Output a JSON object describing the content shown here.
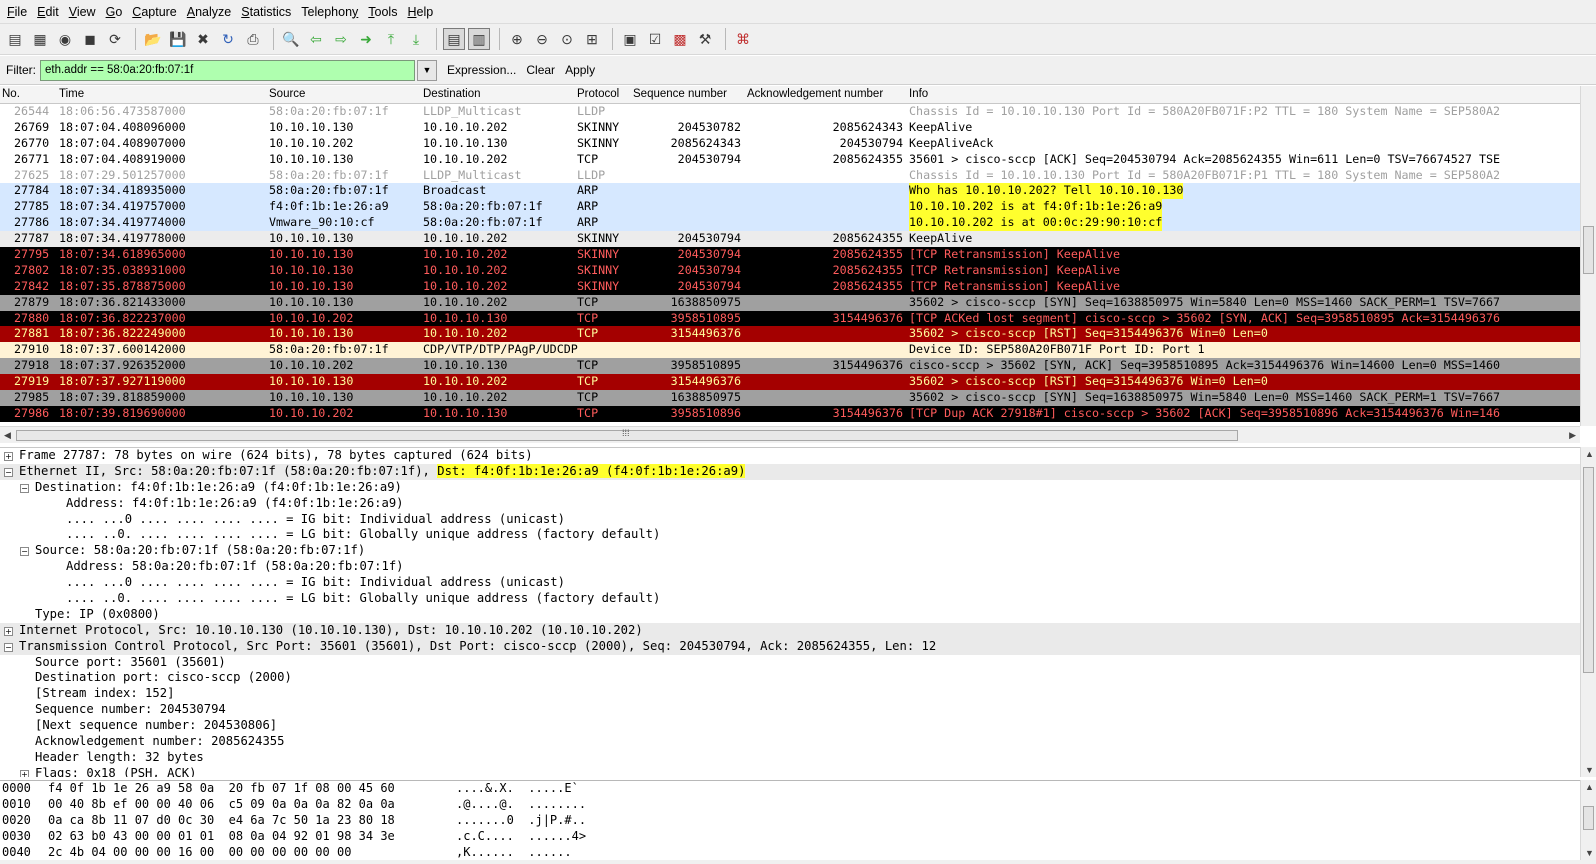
{
  "menu": [
    {
      "pre": "",
      "u": "F",
      "post": "ile"
    },
    {
      "pre": "",
      "u": "E",
      "post": "dit"
    },
    {
      "pre": "",
      "u": "V",
      "post": "iew"
    },
    {
      "pre": "",
      "u": "G",
      "post": "o"
    },
    {
      "pre": "",
      "u": "C",
      "post": "apture"
    },
    {
      "pre": "",
      "u": "A",
      "post": "nalyze"
    },
    {
      "pre": "",
      "u": "S",
      "post": "tatistics"
    },
    {
      "pre": "Telephon",
      "u": "y",
      "post": ""
    },
    {
      "pre": "",
      "u": "T",
      "post": "ools"
    },
    {
      "pre": "",
      "u": "H",
      "post": "elp"
    }
  ],
  "toolbar": [
    {
      "name": "interface-list-icon",
      "glyph": "▤",
      "cls": "ic-dark"
    },
    {
      "name": "capture-options-icon",
      "glyph": "▦",
      "cls": "ic-dark"
    },
    {
      "name": "start-capture-icon",
      "glyph": "◉",
      "cls": "ic-dark"
    },
    {
      "name": "stop-capture-icon",
      "glyph": "◼",
      "cls": "ic-dark"
    },
    {
      "name": "restart-capture-icon",
      "glyph": "⟳",
      "cls": "ic-dark"
    },
    {
      "name": "sep"
    },
    {
      "name": "open-file-icon",
      "glyph": "📂",
      "cls": "ic-orange"
    },
    {
      "name": "save-file-icon",
      "glyph": "💾",
      "cls": "ic-red"
    },
    {
      "name": "close-file-icon",
      "glyph": "✖",
      "cls": "ic-dark"
    },
    {
      "name": "reload-icon",
      "glyph": "↻",
      "cls": "ic-blue"
    },
    {
      "name": "print-icon",
      "glyph": "⎙",
      "cls": "ic-dark"
    },
    {
      "name": "sep"
    },
    {
      "name": "find-packet-icon",
      "glyph": "🔍",
      "cls": "ic-dark"
    },
    {
      "name": "go-back-icon",
      "glyph": "⇦",
      "cls": "ic-green"
    },
    {
      "name": "go-forward-icon",
      "glyph": "⇨",
      "cls": "ic-green"
    },
    {
      "name": "go-to-packet-icon",
      "glyph": "➜",
      "cls": "ic-green"
    },
    {
      "name": "go-first-icon",
      "glyph": "⤒",
      "cls": "ic-green"
    },
    {
      "name": "go-last-icon",
      "glyph": "⤓",
      "cls": "ic-green"
    },
    {
      "name": "sep"
    },
    {
      "name": "colorize-icon",
      "glyph": "▤",
      "cls": "ic-dark",
      "pressed": true
    },
    {
      "name": "auto-scroll-icon",
      "glyph": "▥",
      "cls": "ic-dark",
      "pressed": true
    },
    {
      "name": "sep"
    },
    {
      "name": "zoom-in-icon",
      "glyph": "⊕",
      "cls": "ic-dark"
    },
    {
      "name": "zoom-out-icon",
      "glyph": "⊖",
      "cls": "ic-dark"
    },
    {
      "name": "zoom-normal-icon",
      "glyph": "⊙",
      "cls": "ic-dark"
    },
    {
      "name": "resize-columns-icon",
      "glyph": "⊞",
      "cls": "ic-dark"
    },
    {
      "name": "sep"
    },
    {
      "name": "capture-filters-icon",
      "glyph": "▣",
      "cls": "ic-dark"
    },
    {
      "name": "display-filters-icon",
      "glyph": "☑",
      "cls": "ic-dark"
    },
    {
      "name": "coloring-rules-icon",
      "glyph": "▩",
      "cls": "ic-red"
    },
    {
      "name": "preferences-icon",
      "glyph": "⚒",
      "cls": "ic-dark"
    },
    {
      "name": "sep"
    },
    {
      "name": "help-icon",
      "glyph": "⌘",
      "cls": "ic-red"
    }
  ],
  "filter": {
    "label": "Filter:",
    "value": "eth.addr == 58:0a:20:fb:07:1f",
    "expression": "Expression...",
    "clear": "Clear",
    "apply": "Apply"
  },
  "columns": {
    "no": "No.",
    "time": "Time",
    "source": "Source",
    "destination": "Destination",
    "protocol": "Protocol",
    "seq": "Sequence number",
    "ack": "Acknowledgement number",
    "info": "Info"
  },
  "colors": {
    "lldp_bg": "#ffffff",
    "lldp_fg": "#a0a0a0",
    "skinny_bg": "#ffffff",
    "skinny_fg": "#000000",
    "arp_bg": "#d6e8ff",
    "arp_fg": "#000000",
    "retrans_bg": "#000000",
    "retrans_fg": "#ff5c5c",
    "syn_bg": "#a0a0a0",
    "syn_fg": "#000000",
    "rst_bg": "#a40000",
    "rst_fg": "#fffc9c",
    "cdp_bg": "#fff3d6",
    "cdp_fg": "#000000",
    "highlight": "#ffff2e"
  },
  "packets": [
    {
      "no": "26544",
      "time": "18:06:56.473587000",
      "src": "58:0a:20:fb:07:1f",
      "dst": "LLDP_Multicast",
      "proto": "LLDP",
      "seq": "",
      "ack": "",
      "info": "Chassis Id = 10.10.10.130 Port Id = 580A20FB071F:P2 TTL = 180 System Name = SEP580A2",
      "bg": "#ffffff",
      "fg": "#a0a0a0"
    },
    {
      "no": "26769",
      "time": "18:07:04.408096000",
      "src": "10.10.10.130",
      "dst": "10.10.10.202",
      "proto": "SKINNY",
      "seq": "204530782",
      "ack": "2085624343",
      "info": "KeepAlive",
      "bg": "#ffffff",
      "fg": "#000000"
    },
    {
      "no": "26770",
      "time": "18:07:04.408907000",
      "src": "10.10.10.202",
      "dst": "10.10.10.130",
      "proto": "SKINNY",
      "seq": "2085624343",
      "ack": "204530794",
      "info": "KeepAliveAck",
      "bg": "#ffffff",
      "fg": "#000000"
    },
    {
      "no": "26771",
      "time": "18:07:04.408919000",
      "src": "10.10.10.130",
      "dst": "10.10.10.202",
      "proto": "TCP",
      "seq": "204530794",
      "ack": "2085624355",
      "info": "35601 > cisco-sccp [ACK] Seq=204530794 Ack=2085624355 Win=611 Len=0 TSV=76674527 TSE",
      "bg": "#ffffff",
      "fg": "#000000"
    },
    {
      "no": "27625",
      "time": "18:07:29.501257000",
      "src": "58:0a:20:fb:07:1f",
      "dst": "LLDP_Multicast",
      "proto": "LLDP",
      "seq": "",
      "ack": "",
      "info": "Chassis Id = 10.10.10.130 Port Id = 580A20FB071F:P1 TTL = 180 System Name = SEP580A2",
      "bg": "#ffffff",
      "fg": "#a0a0a0"
    },
    {
      "no": "27784",
      "time": "18:07:34.418935000",
      "src": "58:0a:20:fb:07:1f",
      "dst": "Broadcast",
      "proto": "ARP",
      "seq": "",
      "ack": "",
      "info": "Who has 10.10.10.202?  Tell 10.10.10.130",
      "bg": "#d6e8ff",
      "fg": "#000000",
      "hl": true
    },
    {
      "no": "27785",
      "time": "18:07:34.419757000",
      "src": "f4:0f:1b:1e:26:a9",
      "dst": "58:0a:20:fb:07:1f",
      "proto": "ARP",
      "seq": "",
      "ack": "",
      "info": "10.10.10.202 is at f4:0f:1b:1e:26:a9",
      "bg": "#d6e8ff",
      "fg": "#000000",
      "hl": true
    },
    {
      "no": "27786",
      "time": "18:07:34.419774000",
      "src": "Vmware_90:10:cf",
      "dst": "58:0a:20:fb:07:1f",
      "proto": "ARP",
      "seq": "",
      "ack": "",
      "info": "10.10.10.202 is at 00:0c:29:90:10:cf",
      "bg": "#d6e8ff",
      "fg": "#000000",
      "hl": true
    },
    {
      "no": "27787",
      "time": "18:07:34.419778000",
      "src": "10.10.10.130",
      "dst": "10.10.10.202",
      "proto": "SKINNY",
      "seq": "204530794",
      "ack": "2085624355",
      "info": "KeepAlive",
      "bg": "#ececec",
      "fg": "#000000"
    },
    {
      "no": "27795",
      "time": "18:07:34.618965000",
      "src": "10.10.10.130",
      "dst": "10.10.10.202",
      "proto": "SKINNY",
      "seq": "204530794",
      "ack": "2085624355",
      "info": "[TCP Retransmission] KeepAlive",
      "bg": "#000000",
      "fg": "#ff5c5c"
    },
    {
      "no": "27802",
      "time": "18:07:35.038931000",
      "src": "10.10.10.130",
      "dst": "10.10.10.202",
      "proto": "SKINNY",
      "seq": "204530794",
      "ack": "2085624355",
      "info": "[TCP Retransmission] KeepAlive",
      "bg": "#000000",
      "fg": "#ff5c5c"
    },
    {
      "no": "27842",
      "time": "18:07:35.878875000",
      "src": "10.10.10.130",
      "dst": "10.10.10.202",
      "proto": "SKINNY",
      "seq": "204530794",
      "ack": "2085624355",
      "info": "[TCP Retransmission] KeepAlive",
      "bg": "#000000",
      "fg": "#ff5c5c"
    },
    {
      "no": "27879",
      "time": "18:07:36.821433000",
      "src": "10.10.10.130",
      "dst": "10.10.10.202",
      "proto": "TCP",
      "seq": "1638850975",
      "ack": "",
      "info": "35602 > cisco-sccp [SYN] Seq=1638850975 Win=5840 Len=0 MSS=1460 SACK_PERM=1 TSV=7667",
      "bg": "#a0a0a0",
      "fg": "#000000"
    },
    {
      "no": "27880",
      "time": "18:07:36.822237000",
      "src": "10.10.10.202",
      "dst": "10.10.10.130",
      "proto": "TCP",
      "seq": "3958510895",
      "ack": "3154496376",
      "info": "[TCP ACKed lost segment] cisco-sccp > 35602 [SYN, ACK] Seq=3958510895 Ack=3154496376",
      "bg": "#000000",
      "fg": "#ff5c5c"
    },
    {
      "no": "27881",
      "time": "18:07:36.822249000",
      "src": "10.10.10.130",
      "dst": "10.10.10.202",
      "proto": "TCP",
      "seq": "3154496376",
      "ack": "",
      "info": "35602 > cisco-sccp [RST] Seq=3154496376 Win=0 Len=0",
      "bg": "#a40000",
      "fg": "#fffc9c"
    },
    {
      "no": "27910",
      "time": "18:07:37.600142000",
      "src": "58:0a:20:fb:07:1f",
      "dst": "CDP/VTP/DTP/PAgP/UDCDP",
      "proto": "",
      "seq": "",
      "ack": "",
      "info": "Device ID: SEP580A20FB071F  Port ID: Port 1",
      "bg": "#fff3d6",
      "fg": "#000000"
    },
    {
      "no": "27918",
      "time": "18:07:37.926352000",
      "src": "10.10.10.202",
      "dst": "10.10.10.130",
      "proto": "TCP",
      "seq": "3958510895",
      "ack": "3154496376",
      "info": "cisco-sccp > 35602 [SYN, ACK] Seq=3958510895 Ack=3154496376 Win=14600 Len=0 MSS=1460",
      "bg": "#a0a0a0",
      "fg": "#000000"
    },
    {
      "no": "27919",
      "time": "18:07:37.927119000",
      "src": "10.10.10.130",
      "dst": "10.10.10.202",
      "proto": "TCP",
      "seq": "3154496376",
      "ack": "",
      "info": "35602 > cisco-sccp [RST] Seq=3154496376 Win=0 Len=0",
      "bg": "#a40000",
      "fg": "#fffc9c"
    },
    {
      "no": "27985",
      "time": "18:07:39.818859000",
      "src": "10.10.10.130",
      "dst": "10.10.10.202",
      "proto": "TCP",
      "seq": "1638850975",
      "ack": "",
      "info": "35602 > cisco-sccp [SYN] Seq=1638850975 Win=5840 Len=0 MSS=1460 SACK_PERM=1 TSV=7667",
      "bg": "#a0a0a0",
      "fg": "#000000"
    },
    {
      "no": "27986",
      "time": "18:07:39.819690000",
      "src": "10.10.10.202",
      "dst": "10.10.10.130",
      "proto": "TCP",
      "seq": "3958510896",
      "ack": "3154496376",
      "info": "[TCP Dup ACK 27918#1] cisco-sccp > 35602 [ACK] Seq=3958510896 Ack=3154496376 Win=146",
      "bg": "#000000",
      "fg": "#ff5c5c"
    }
  ],
  "details": [
    {
      "indent": 0,
      "exp": "+",
      "text": "Frame 27787: 78 bytes on wire (624 bits), 78 bytes captured (624 bits)"
    },
    {
      "indent": 0,
      "exp": "−",
      "text": "Ethernet II, Src: 58:0a:20:fb:07:1f (58:0a:20:fb:07:1f), ",
      "hl": "Dst: f4:0f:1b:1e:26:a9 (f4:0f:1b:1e:26:a9)",
      "sel": true
    },
    {
      "indent": 1,
      "exp": "−",
      "text": "Destination: f4:0f:1b:1e:26:a9 (f4:0f:1b:1e:26:a9)"
    },
    {
      "indent": 2,
      "exp": "",
      "text": "Address: f4:0f:1b:1e:26:a9 (f4:0f:1b:1e:26:a9)"
    },
    {
      "indent": 2,
      "exp": "",
      "text": ".... ...0 .... .... .... .... = IG bit: Individual address (unicast)"
    },
    {
      "indent": 2,
      "exp": "",
      "text": ".... ..0. .... .... .... .... = LG bit: Globally unique address (factory default)"
    },
    {
      "indent": 1,
      "exp": "−",
      "text": "Source: 58:0a:20:fb:07:1f (58:0a:20:fb:07:1f)"
    },
    {
      "indent": 2,
      "exp": "",
      "text": "Address: 58:0a:20:fb:07:1f (58:0a:20:fb:07:1f)"
    },
    {
      "indent": 2,
      "exp": "",
      "text": ".... ...0 .... .... .... .... = IG bit: Individual address (unicast)"
    },
    {
      "indent": 2,
      "exp": "",
      "text": ".... ..0. .... .... .... .... = LG bit: Globally unique address (factory default)"
    },
    {
      "indent": 1,
      "exp": "",
      "text": "Type: IP (0x0800)"
    },
    {
      "indent": 0,
      "exp": "+",
      "text": "Internet Protocol, Src: 10.10.10.130 (10.10.10.130), Dst: 10.10.10.202 (10.10.10.202)",
      "sel": true
    },
    {
      "indent": 0,
      "exp": "−",
      "text": "Transmission Control Protocol, Src Port: 35601 (35601), Dst Port: cisco-sccp (2000), Seq: 204530794, Ack: 2085624355, Len: 12",
      "sel": true
    },
    {
      "indent": 1,
      "exp": "",
      "text": "Source port: 35601 (35601)"
    },
    {
      "indent": 1,
      "exp": "",
      "text": "Destination port: cisco-sccp (2000)"
    },
    {
      "indent": 1,
      "exp": "",
      "text": "[Stream index: 152]"
    },
    {
      "indent": 1,
      "exp": "",
      "text": "Sequence number: 204530794"
    },
    {
      "indent": 1,
      "exp": "",
      "text": "[Next sequence number: 204530806]"
    },
    {
      "indent": 1,
      "exp": "",
      "text": "Acknowledgement number: 2085624355"
    },
    {
      "indent": 1,
      "exp": "",
      "text": "Header length: 32 bytes"
    },
    {
      "indent": 1,
      "exp": "+",
      "text": "Flags: 0x18 (PSH, ACK)"
    }
  ],
  "hex": [
    {
      "offset": "0000",
      "bytes": "f4 0f 1b 1e 26 a9 58 0a  20 fb 07 1f 08 00 45 60",
      "ascii": "....&.X.  .....E`"
    },
    {
      "offset": "0010",
      "bytes": "00 40 8b ef 00 00 40 06  c5 09 0a 0a 0a 82 0a 0a",
      "ascii": ".@....@.  ........"
    },
    {
      "offset": "0020",
      "bytes": "0a ca 8b 11 07 d0 0c 30  e4 6a 7c 50 1a 23 80 18",
      "ascii": ".......0  .j|P.#.."
    },
    {
      "offset": "0030",
      "bytes": "02 63 b0 43 00 00 01 01  08 0a 04 92 01 98 34 3e",
      "ascii": ".c.C....  ......4>"
    },
    {
      "offset": "0040",
      "bytes": "2c 4b 04 00 00 00 16 00  00 00 00 00 00 00",
      "ascii": ",K......  ......"
    }
  ]
}
